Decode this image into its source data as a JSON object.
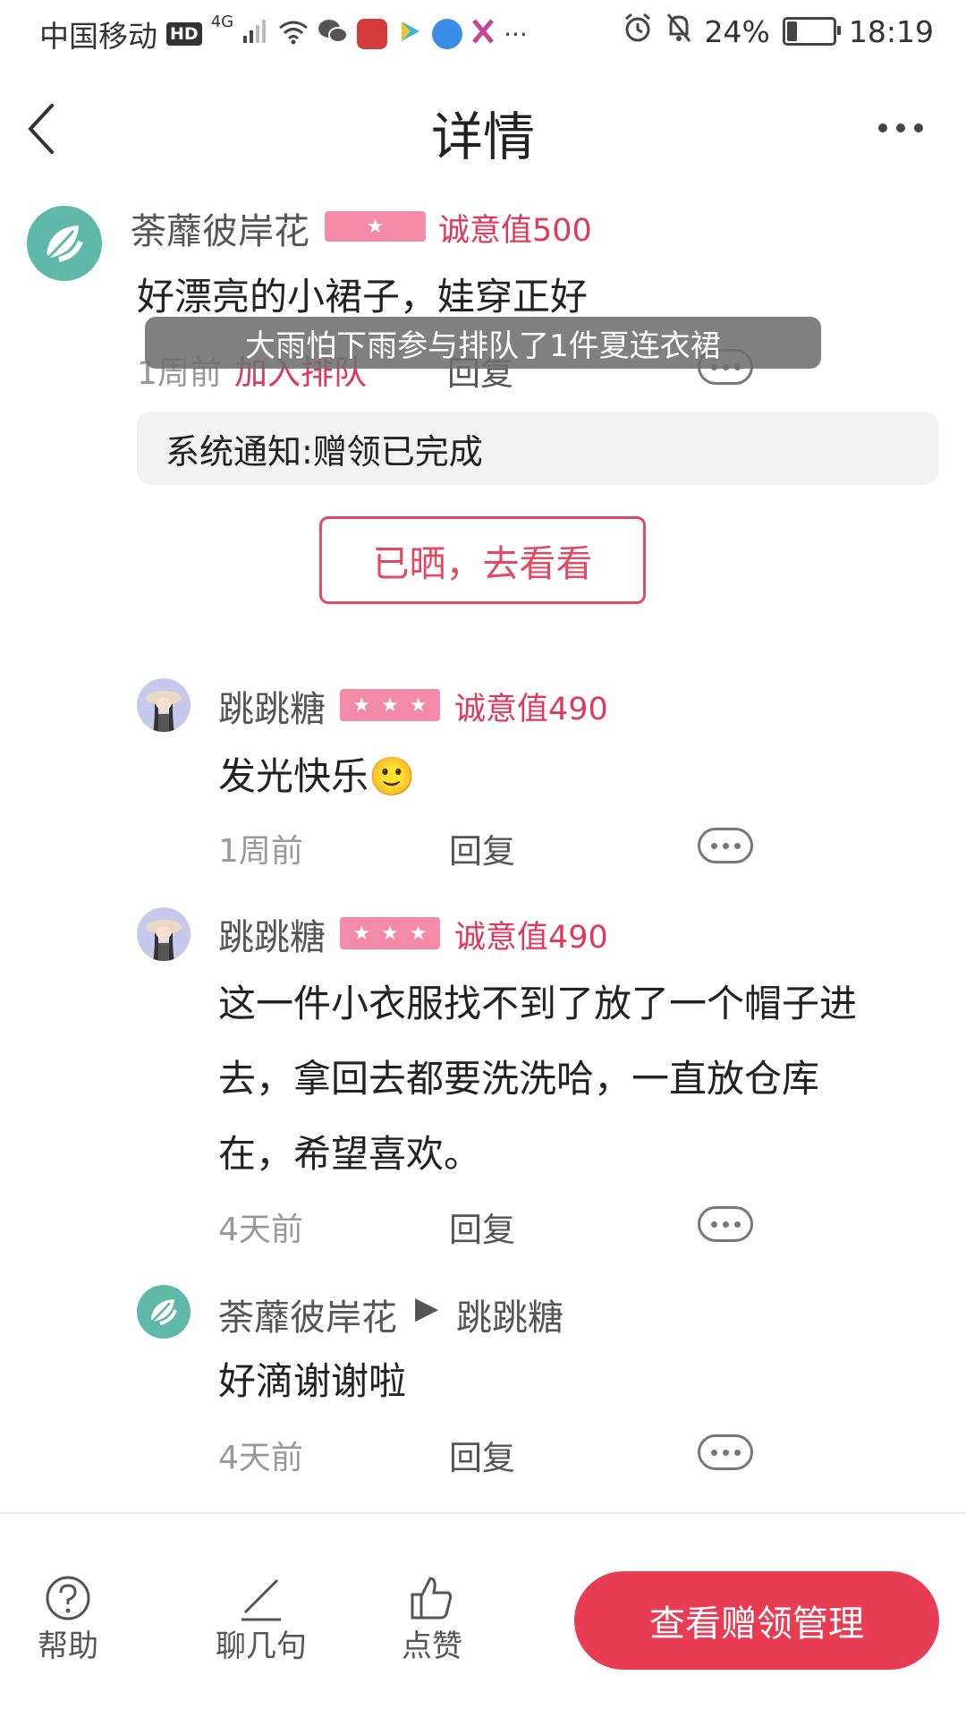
{
  "status_bar": {
    "carrier": "中国移动",
    "hd": "HD",
    "network": "4G",
    "battery": "24%",
    "battery_level": 0.24,
    "time": "18:19"
  },
  "header": {
    "title": "详情"
  },
  "post": {
    "author": "荼蘼彼岸花",
    "stars": 1,
    "sincerity": "诚意值500",
    "content": "好漂亮的小裙子，娃穿正好",
    "time": "1周前",
    "join_queue": "加入排队",
    "reply_label": "回复",
    "toast": "大雨怕下雨参与排队了1件夏连衣裙",
    "notice": "系统通知:赠领已完成",
    "see_button": "已晒，去看看"
  },
  "comments": [
    {
      "author": "跳跳糖",
      "stars": 3,
      "sincerity": "诚意值490",
      "content": "发光快乐🙂",
      "time": "1周前",
      "reply_label": "回复"
    },
    {
      "author": "跳跳糖",
      "stars": 3,
      "sincerity": "诚意值490",
      "content_lines": [
        "这一件小衣服找不到了放了一个帽子进",
        "去，拿回去都要洗洗哈，一直放仓库",
        "在，希望喜欢。"
      ],
      "time": "4天前",
      "reply_label": "回复"
    },
    {
      "author": "荼蘼彼岸花",
      "reply_arrow": "▶",
      "reply_to": "跳跳糖",
      "content": "好滴谢谢啦",
      "time": "4天前",
      "reply_label": "回复"
    }
  ],
  "bottom_bar": {
    "help": "帮助",
    "chat": "聊几句",
    "like": "点赞",
    "manage_button": "查看赠领管理"
  },
  "colors": {
    "accent": "#e73c53",
    "badge": "#f28aa8",
    "sincerity": "#e0385a"
  }
}
